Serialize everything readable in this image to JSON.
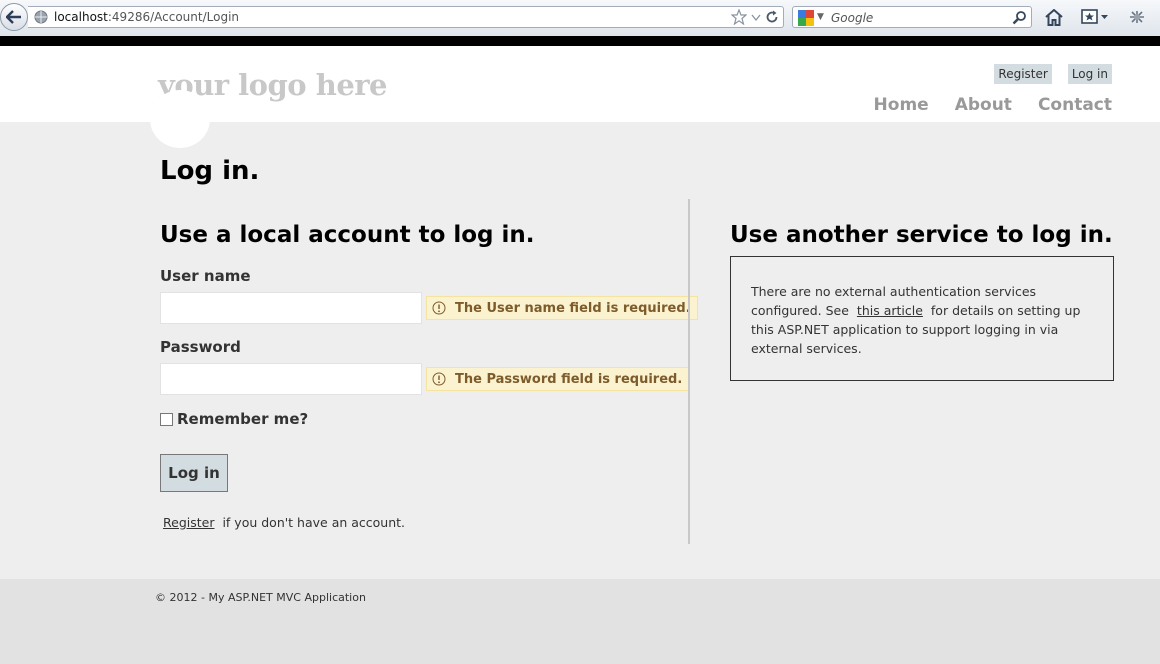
{
  "browser": {
    "url_host": "localhost",
    "url_path": ":49286/Account/Login",
    "search_placeholder": "Google"
  },
  "header": {
    "logo_text": "your logo here",
    "auth_links": {
      "register": "Register",
      "login": "Log in"
    },
    "nav": {
      "home": "Home",
      "about": "About",
      "contact": "Contact"
    }
  },
  "page": {
    "title": "Log in."
  },
  "local_login": {
    "title": "Use a local account to log in.",
    "username_label": "User name",
    "username_value": "",
    "username_error": "The User name field is required.",
    "password_label": "Password",
    "password_value": "",
    "password_error": "The Password field is required.",
    "remember_label": "Remember me?",
    "submit_label": "Log in",
    "register_link": "Register",
    "register_suffix": "if you don't have an account."
  },
  "external_login": {
    "title": "Use another service to log in.",
    "message_before": "There are no external authentication services configured. See",
    "article_link": "this article",
    "message_after": "for details on setting up this ASP.NET application to support logging in via external services."
  },
  "footer": {
    "copyright": "© 2012 - My ASP.NET MVC Application"
  },
  "colors": {
    "accent": "#d3dce0",
    "main_background": "#efeeef",
    "validation_background": "#fbf3cf",
    "validation_text": "#7d5b2a"
  }
}
